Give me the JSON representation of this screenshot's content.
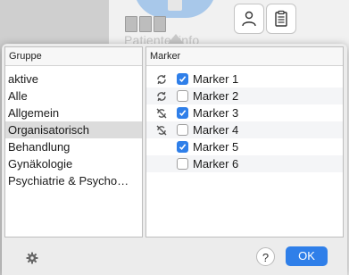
{
  "background": {
    "label": "Patienteninfo"
  },
  "groups": {
    "header": "Gruppe",
    "items": [
      {
        "label": "aktive",
        "selected": false
      },
      {
        "label": "Alle",
        "selected": false
      },
      {
        "label": "Allgemein",
        "selected": false
      },
      {
        "label": "Organisatorisch",
        "selected": true
      },
      {
        "label": "Behandlung",
        "selected": false
      },
      {
        "label": "Gynäkologie",
        "selected": false
      },
      {
        "label": "Psychiatrie & Psycho…",
        "selected": false
      }
    ]
  },
  "markers": {
    "header": "Marker",
    "items": [
      {
        "label": "Marker 1",
        "checked": true,
        "status_icon": "sync-icon"
      },
      {
        "label": "Marker 2",
        "checked": false,
        "status_icon": "sync-icon"
      },
      {
        "label": "Marker 3",
        "checked": true,
        "status_icon": "sync-disabled-icon"
      },
      {
        "label": "Marker 4",
        "checked": false,
        "status_icon": "sync-disabled-icon"
      },
      {
        "label": "Marker 5",
        "checked": true,
        "status_icon": ""
      },
      {
        "label": "Marker 6",
        "checked": false,
        "status_icon": ""
      }
    ]
  },
  "footer": {
    "help_label": "?",
    "ok_label": "OK"
  },
  "colors": {
    "accent": "#2f7fe9",
    "selected_row": "#dcdcdc"
  }
}
